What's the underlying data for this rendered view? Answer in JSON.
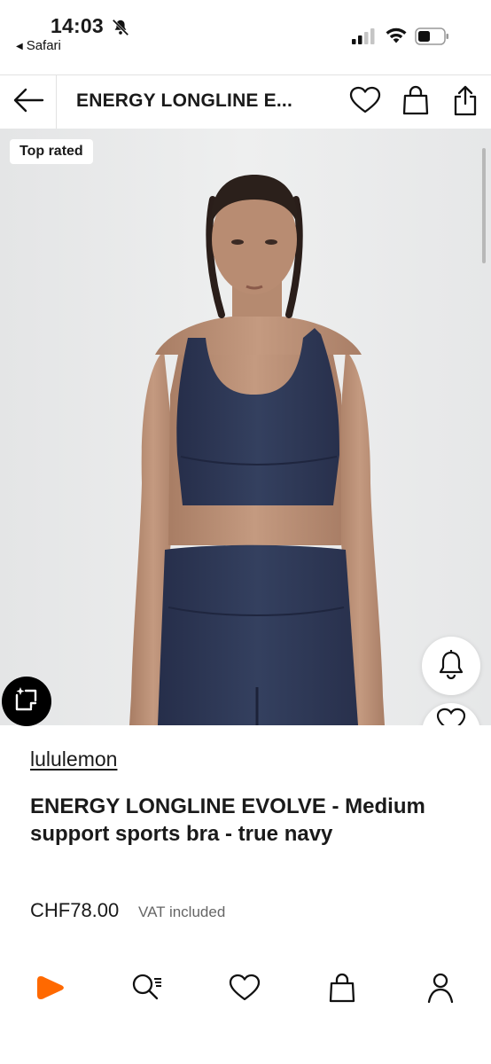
{
  "status_bar": {
    "time": "14:03",
    "back_app": "Safari",
    "icons": [
      "bell-slash-icon",
      "signal-icon",
      "wifi-icon",
      "battery-icon"
    ]
  },
  "header": {
    "title": "ENERGY LONGLINE E...",
    "icons": [
      "back-arrow-icon",
      "heart-icon",
      "bag-icon",
      "share-icon"
    ]
  },
  "hero": {
    "badge": "Top rated",
    "fab_icons": [
      "bell-icon",
      "heart-icon",
      "ai-lens-icon"
    ],
    "colors": {
      "background": "#e9eaea",
      "garment": "#2d3553"
    }
  },
  "product": {
    "brand": "lululemon",
    "name": "ENERGY LONGLINE EVOLVE - Medium support sports bra - true navy",
    "price": "CHF78.00",
    "vat_note": "VAT included"
  },
  "tab_bar": {
    "items": [
      "home-play-icon",
      "search-icon",
      "wishlist-heart-icon",
      "bag-icon",
      "profile-icon"
    ],
    "accent": "#ff6900"
  }
}
